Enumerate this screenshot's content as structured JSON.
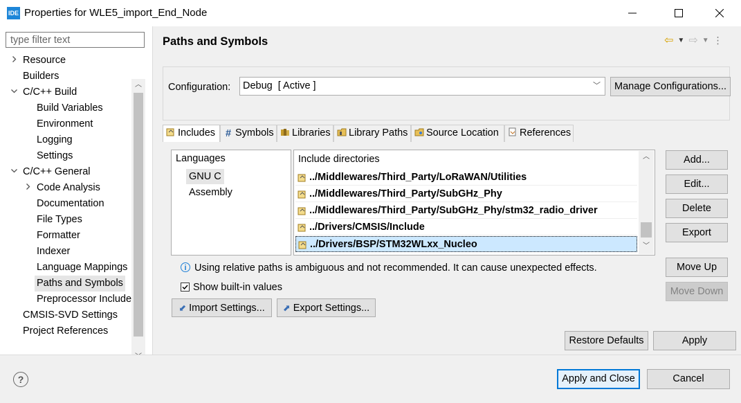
{
  "window": {
    "app_icon": "IDE",
    "title": "Properties for WLE5_import_End_Node",
    "minimize_icon": "minimize-icon",
    "maximize_icon": "maximize-icon",
    "close_icon": "close-icon"
  },
  "sidebar": {
    "filter_placeholder": "type filter text",
    "items": [
      {
        "label": "Resource",
        "level": 0,
        "chevron": "right"
      },
      {
        "label": "Builders",
        "level": 0,
        "chevron": ""
      },
      {
        "label": "C/C++ Build",
        "level": 0,
        "chevron": "down"
      },
      {
        "label": "Build Variables",
        "level": 1,
        "chevron": ""
      },
      {
        "label": "Environment",
        "level": 1,
        "chevron": ""
      },
      {
        "label": "Logging",
        "level": 1,
        "chevron": ""
      },
      {
        "label": "Settings",
        "level": 1,
        "chevron": ""
      },
      {
        "label": "C/C++ General",
        "level": 0,
        "chevron": "down"
      },
      {
        "label": "Code Analysis",
        "level": 1,
        "chevron": "right"
      },
      {
        "label": "Documentation",
        "level": 1,
        "chevron": ""
      },
      {
        "label": "File Types",
        "level": 1,
        "chevron": ""
      },
      {
        "label": "Formatter",
        "level": 1,
        "chevron": ""
      },
      {
        "label": "Indexer",
        "level": 1,
        "chevron": ""
      },
      {
        "label": "Language Mappings",
        "level": 1,
        "chevron": ""
      },
      {
        "label": "Paths and Symbols",
        "level": 1,
        "chevron": "",
        "selected": true
      },
      {
        "label": "Preprocessor Include",
        "level": 1,
        "chevron": ""
      },
      {
        "label": "CMSIS-SVD Settings",
        "level": 0,
        "chevron": ""
      },
      {
        "label": "Project References",
        "level": 0,
        "chevron": ""
      }
    ]
  },
  "main": {
    "title": "Paths and Symbols",
    "configuration_label": "Configuration:",
    "configuration_value": "Debug  [ Active ]",
    "manage_configurations": "Manage Configurations...",
    "tabs": [
      {
        "label": "Includes",
        "icon": "includes-icon",
        "active": true
      },
      {
        "label": "Symbols",
        "icon": "hash-icon"
      },
      {
        "label": "Libraries",
        "icon": "libraries-icon"
      },
      {
        "label": "Library Paths",
        "icon": "library-paths-icon"
      },
      {
        "label": "Source Location",
        "icon": "source-folder-icon"
      },
      {
        "label": "References",
        "icon": "references-icon"
      }
    ],
    "languages_header": "Languages",
    "languages": [
      "GNU C",
      "Assembly"
    ],
    "selected_language": "GNU C",
    "include_header": "Include directories",
    "include_dirs": [
      "../Middlewares/Third_Party/LoRaWAN/Utilities",
      "../Middlewares/Third_Party/SubGHz_Phy",
      "../Middlewares/Third_Party/SubGHz_Phy/stm32_radio_driver",
      "../Drivers/CMSIS/Include",
      "../Drivers/BSP/STM32WLxx_Nucleo"
    ],
    "selected_include": "../Drivers/BSP/STM32WLxx_Nucleo",
    "side_buttons": {
      "add": "Add...",
      "edit": "Edit...",
      "delete": "Delete",
      "export": "Export",
      "move_up": "Move Up",
      "move_down": "Move Down"
    },
    "info_text": "Using relative paths is ambiguous and not recommended. It can cause unexpected effects.",
    "show_builtin_label": "Show built-in values",
    "show_builtin_checked": true,
    "import_settings": "Import Settings...",
    "export_settings": "Export Settings...",
    "restore_defaults": "Restore Defaults",
    "apply": "Apply"
  },
  "footer": {
    "help_icon": "help-icon",
    "apply_and_close": "Apply and Close",
    "cancel": "Cancel"
  },
  "colors": {
    "accent": "#0078d7",
    "selection": "#cce8ff",
    "panel": "#f0f0f0"
  }
}
